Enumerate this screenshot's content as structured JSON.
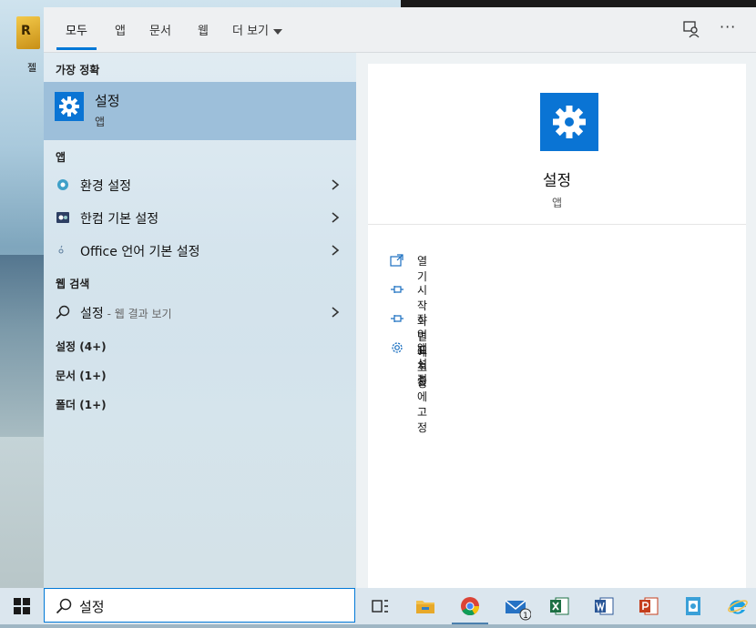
{
  "desktop": {
    "icon_label": "젤",
    "icon_glyph": "R"
  },
  "tabs": [
    {
      "label": "모두"
    },
    {
      "label": "앱"
    },
    {
      "label": "문서"
    },
    {
      "label": "웹"
    },
    {
      "label": "더 보기"
    }
  ],
  "left": {
    "best_match_header": "가장 정확",
    "best_match": {
      "title": "설정",
      "type": "앱"
    },
    "apps_header": "앱",
    "apps": [
      {
        "label": "환경 설정"
      },
      {
        "label": "한컴 기본 설정"
      },
      {
        "label": "Office 언어 기본 설정"
      }
    ],
    "web_header": "웹 검색",
    "web_item": {
      "query": "설정",
      "hint": " - 웹 결과 보기"
    },
    "categories": [
      {
        "label": "설정 (4+)"
      },
      {
        "label": "문서 (1+)"
      },
      {
        "label": "폴더 (1+)"
      }
    ]
  },
  "right": {
    "title": "설정",
    "subtitle": "앱",
    "actions": [
      {
        "label": "열기",
        "icon": "open-icon"
      },
      {
        "label": "시작 화면에 고정",
        "icon": "pin-icon"
      },
      {
        "label": "작업 표시줄에 고정",
        "icon": "pin-icon"
      },
      {
        "label": "앱 설정",
        "icon": "gear-icon"
      }
    ]
  },
  "search": {
    "value": "설정"
  },
  "taskbar": {
    "mail_badge": "1"
  },
  "colors": {
    "accent": "#0078d7",
    "tile": "#0a74d4",
    "selected": "#9dbfda"
  }
}
